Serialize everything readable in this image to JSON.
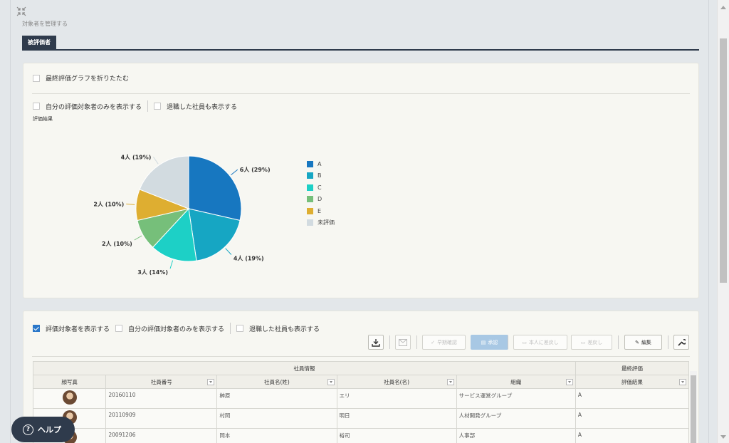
{
  "header": {
    "subtitle": "対象者を管理する",
    "tab_label": "被評価者"
  },
  "panel1": {
    "collapse_label": "最終評価グラフを折りたたむ",
    "only_mine_label": "自分の評価対象者のみを表示する",
    "show_retired_label": "退職した社員も表示する",
    "section_label": "評価結果"
  },
  "chart_data": {
    "type": "pie",
    "title": "評価結果",
    "slices": [
      {
        "label": "A",
        "value": 6,
        "percent": 29,
        "data_label": "6人 (29%)",
        "color": "#1777c0"
      },
      {
        "label": "B",
        "value": 4,
        "percent": 19,
        "data_label": "4人 (19%)",
        "color": "#16a6c3"
      },
      {
        "label": "C",
        "value": 3,
        "percent": 14,
        "data_label": "3人 (14%)",
        "color": "#1dd0c6"
      },
      {
        "label": "D",
        "value": 2,
        "percent": 10,
        "data_label": "2人 (10%)",
        "color": "#76bf7a"
      },
      {
        "label": "E",
        "value": 2,
        "percent": 10,
        "data_label": "2人 (10%)",
        "color": "#deae31"
      },
      {
        "label": "未評価",
        "value": 4,
        "percent": 19,
        "data_label": "4人 (19%)",
        "color": "#d2dbe0"
      }
    ],
    "legend_position": "right"
  },
  "panel2": {
    "show_targets_label": "評価対象者を表示する",
    "only_mine_label": "自分の評価対象者のみを表示する",
    "show_retired_label": "退職した社員も表示する",
    "toolbar": {
      "batch_confirm": "早期確認",
      "approve": "承認",
      "return_to_self": "本人に差戻し",
      "return": "差戻し",
      "edit": "編集"
    },
    "table": {
      "group_employee": "社員情報",
      "group_final": "最終評価",
      "columns": [
        "顔写真",
        "社員番号",
        "社員名(姓)",
        "社員名(名)",
        "組織",
        "評価結果"
      ],
      "rows": [
        {
          "id": "20160110",
          "last": "榊原",
          "first": "エリ",
          "org": "サービス運営グループ",
          "result": "A"
        },
        {
          "id": "20110909",
          "last": "村岡",
          "first": "明日",
          "org": "人材開発グループ",
          "result": "A"
        },
        {
          "id": "20091206",
          "last": "岡本",
          "first": "裕司",
          "org": "人事部",
          "result": "A"
        }
      ]
    }
  },
  "help": {
    "label": "ヘルプ"
  }
}
